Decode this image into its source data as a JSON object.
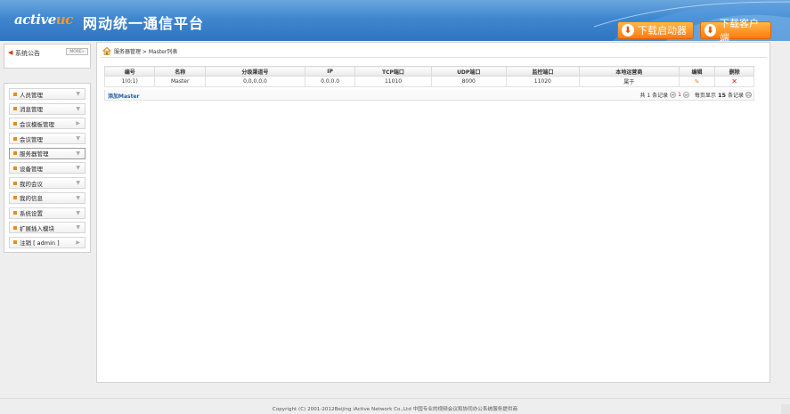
{
  "header": {
    "logo_main": "active",
    "logo_accent": "uc",
    "title": "网动统一通信平台",
    "download_launcher": "下载启动器",
    "download_client": "下载客户端"
  },
  "sidebar": {
    "notice_label": "系统公告",
    "more_label": "MORE»",
    "menu": [
      {
        "label": "人员管理"
      },
      {
        "label": "消息管理"
      },
      {
        "label": "会议模板管理"
      },
      {
        "label": "会议管理"
      },
      {
        "label": "服务器管理"
      },
      {
        "label": "设备管理"
      },
      {
        "label": "我的会议"
      },
      {
        "label": "我的信息"
      },
      {
        "label": "系统设置"
      },
      {
        "label": "扩展插入模块"
      },
      {
        "label": "注销 [ admin ]"
      }
    ]
  },
  "breadcrumb": {
    "text": "服务器管理 > Master列表"
  },
  "table": {
    "columns": [
      "编号",
      "名称",
      "分级渠道号",
      "IP",
      "TCP端口",
      "UDP端口",
      "监控端口",
      "本地运营商",
      "编辑",
      "删除"
    ],
    "rows": [
      {
        "id": "1(0:1)",
        "name": "Master",
        "channel": "0,0,0,0,0",
        "ip": "0.0.0.0",
        "tcp": "11010",
        "udp": "8000",
        "monitor": "11020",
        "operator": "属于"
      }
    ],
    "add_link": "添加Master",
    "pager": {
      "total_prefix": "共 1 条记录",
      "current_page": "1",
      "page_size_prefix": "每页显示",
      "page_size": "15",
      "page_size_suffix": "条记录",
      "first_label": "⏮",
      "last_label": "⏭"
    }
  },
  "footer": {
    "copyright": "Copyright (C) 2001-2012Beijing iActive Network Co.,Ltd 中国专业的视频会议和协同办公系统服务提供商"
  },
  "colors": {
    "header_blue": "#3f86cf",
    "accent_orange": "#ff7a10",
    "link_blue": "#1a5fb4",
    "delete_red": "#e02020"
  }
}
